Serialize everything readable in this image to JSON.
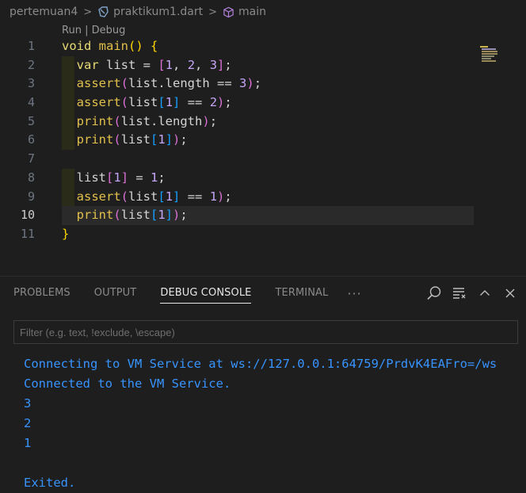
{
  "breadcrumb": {
    "folder": "pertemuan4",
    "file": "praktikum1.dart",
    "symbol": "main"
  },
  "codelens": {
    "run": "Run",
    "sep": " | ",
    "debug": "Debug"
  },
  "editor": {
    "line_numbers": [
      "1",
      "2",
      "3",
      "4",
      "5",
      "6",
      "7",
      "8",
      "9",
      "10",
      "11"
    ],
    "active_line": 10,
    "lines": [
      [
        {
          "t": "void",
          "c": "kw"
        },
        {
          "t": " ",
          "c": "txt"
        },
        {
          "t": "main",
          "c": "fn"
        },
        {
          "t": "()",
          "c": "brk1"
        },
        {
          "t": " ",
          "c": "txt"
        },
        {
          "t": "{",
          "c": "brk1"
        }
      ],
      [
        {
          "t": "  ",
          "c": "txt"
        },
        {
          "t": "var",
          "c": "kw"
        },
        {
          "t": " list = ",
          "c": "txt"
        },
        {
          "t": "[",
          "c": "brk2"
        },
        {
          "t": "1",
          "c": "num"
        },
        {
          "t": ", ",
          "c": "txt"
        },
        {
          "t": "2",
          "c": "num"
        },
        {
          "t": ", ",
          "c": "txt"
        },
        {
          "t": "3",
          "c": "num"
        },
        {
          "t": "]",
          "c": "brk2"
        },
        {
          "t": ";",
          "c": "txt"
        }
      ],
      [
        {
          "t": "  ",
          "c": "txt"
        },
        {
          "t": "assert",
          "c": "fn"
        },
        {
          "t": "(",
          "c": "brk2"
        },
        {
          "t": "list.length == ",
          "c": "txt"
        },
        {
          "t": "3",
          "c": "num"
        },
        {
          "t": ")",
          "c": "brk2"
        },
        {
          "t": ";",
          "c": "txt"
        }
      ],
      [
        {
          "t": "  ",
          "c": "txt"
        },
        {
          "t": "assert",
          "c": "fn"
        },
        {
          "t": "(",
          "c": "brk2"
        },
        {
          "t": "list",
          "c": "txt"
        },
        {
          "t": "[",
          "c": "brk3"
        },
        {
          "t": "1",
          "c": "num"
        },
        {
          "t": "]",
          "c": "brk3"
        },
        {
          "t": " == ",
          "c": "txt"
        },
        {
          "t": "2",
          "c": "num"
        },
        {
          "t": ")",
          "c": "brk2"
        },
        {
          "t": ";",
          "c": "txt"
        }
      ],
      [
        {
          "t": "  ",
          "c": "txt"
        },
        {
          "t": "print",
          "c": "fn"
        },
        {
          "t": "(",
          "c": "brk2"
        },
        {
          "t": "list.length",
          "c": "txt"
        },
        {
          "t": ")",
          "c": "brk2"
        },
        {
          "t": ";",
          "c": "txt"
        }
      ],
      [
        {
          "t": "  ",
          "c": "txt"
        },
        {
          "t": "print",
          "c": "fn"
        },
        {
          "t": "(",
          "c": "brk2"
        },
        {
          "t": "list",
          "c": "txt"
        },
        {
          "t": "[",
          "c": "brk3"
        },
        {
          "t": "1",
          "c": "num"
        },
        {
          "t": "]",
          "c": "brk3"
        },
        {
          "t": ")",
          "c": "brk2"
        },
        {
          "t": ";",
          "c": "txt"
        }
      ],
      [],
      [
        {
          "t": "  ",
          "c": "txt"
        },
        {
          "t": "list",
          "c": "txt"
        },
        {
          "t": "[",
          "c": "brk2"
        },
        {
          "t": "1",
          "c": "num"
        },
        {
          "t": "]",
          "c": "brk2"
        },
        {
          "t": " = ",
          "c": "txt"
        },
        {
          "t": "1",
          "c": "num"
        },
        {
          "t": ";",
          "c": "txt"
        }
      ],
      [
        {
          "t": "  ",
          "c": "txt"
        },
        {
          "t": "assert",
          "c": "fn"
        },
        {
          "t": "(",
          "c": "brk2"
        },
        {
          "t": "list",
          "c": "txt"
        },
        {
          "t": "[",
          "c": "brk3"
        },
        {
          "t": "1",
          "c": "num"
        },
        {
          "t": "]",
          "c": "brk3"
        },
        {
          "t": " == ",
          "c": "txt"
        },
        {
          "t": "1",
          "c": "num"
        },
        {
          "t": ")",
          "c": "brk2"
        },
        {
          "t": ";",
          "c": "txt"
        }
      ],
      [
        {
          "t": "  ",
          "c": "txt"
        },
        {
          "t": "print",
          "c": "fn"
        },
        {
          "t": "(",
          "c": "brk2"
        },
        {
          "t": "list",
          "c": "txt"
        },
        {
          "t": "[",
          "c": "brk3"
        },
        {
          "t": "1",
          "c": "num"
        },
        {
          "t": "]",
          "c": "brk3"
        },
        {
          "t": ")",
          "c": "brk2"
        },
        {
          "t": ";",
          "c": "txt"
        }
      ],
      [
        {
          "t": "}",
          "c": "brk1"
        }
      ]
    ]
  },
  "panel": {
    "tabs": [
      {
        "label": "PROBLEMS",
        "active": false
      },
      {
        "label": "OUTPUT",
        "active": false
      },
      {
        "label": "DEBUG CONSOLE",
        "active": true
      },
      {
        "label": "TERMINAL",
        "active": false
      }
    ],
    "more_label": "···",
    "action_icons": [
      "search-icon",
      "word-wrap-icon",
      "maximize-panel-icon",
      "close-icon"
    ],
    "filter_placeholder": "Filter (e.g. text, !exclude, \\escape)",
    "console_lines": [
      "Connecting to VM Service at ws://127.0.0.1:64759/PrdvK4EAFro=/ws",
      "Connected to the VM Service.",
      "3",
      "2",
      "1",
      "",
      "Exited."
    ]
  },
  "colors": {
    "background": "#1e1e1e",
    "console_text": "#3794ff",
    "keyword": "#e6db74",
    "number": "#c5a5f5",
    "active_tab": "#e7e7e7"
  }
}
